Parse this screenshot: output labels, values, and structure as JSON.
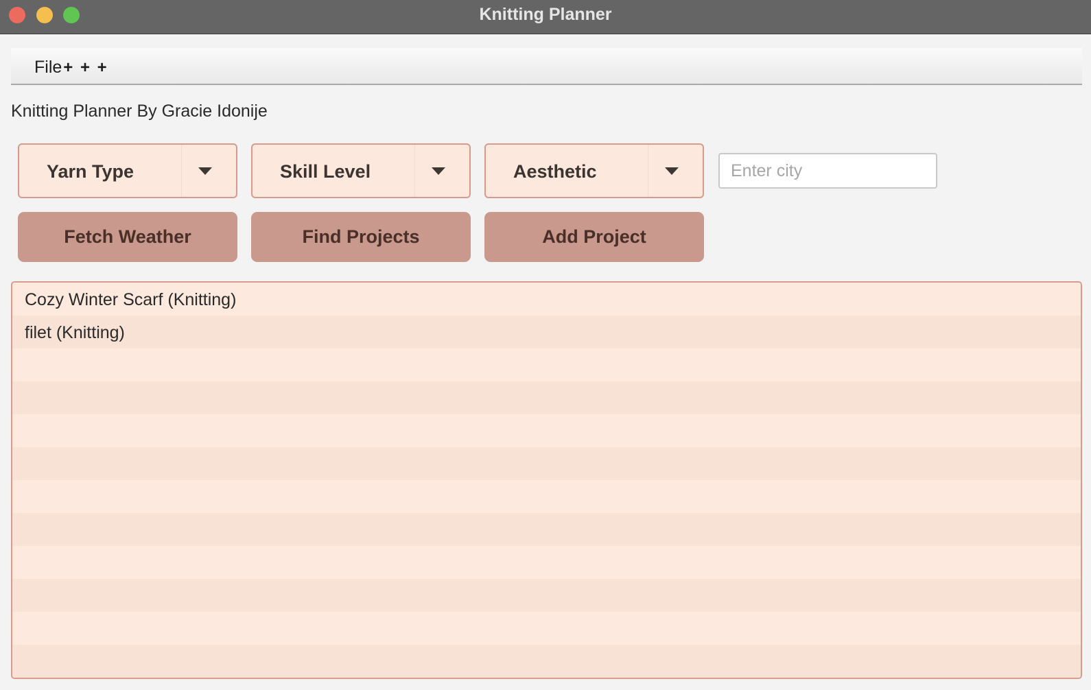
{
  "window": {
    "title": "Knitting Planner"
  },
  "menubar": {
    "file_label": "File",
    "file_extra": "+ + +"
  },
  "app": {
    "heading": "Knitting Planner By Gracie Idonije"
  },
  "filters": {
    "yarn_type": "Yarn Type",
    "skill_level": "Skill Level",
    "aesthetic": "Aesthetic",
    "city_placeholder": "Enter city",
    "city_value": ""
  },
  "actions": {
    "fetch_weather": "Fetch Weather",
    "find_projects": "Find Projects",
    "add_project": "Add Project"
  },
  "projects": [
    "Cozy Winter Scarf (Knitting)",
    "filet (Knitting)",
    "",
    "",
    "",
    "",
    "",
    "",
    "",
    "",
    "",
    ""
  ],
  "colors": {
    "accent_button": "#c8998c",
    "combo_background": "#fde8de",
    "border": "#d89a8c",
    "list_background": "#fde9de",
    "list_alt_row": "#f8e2d6"
  }
}
